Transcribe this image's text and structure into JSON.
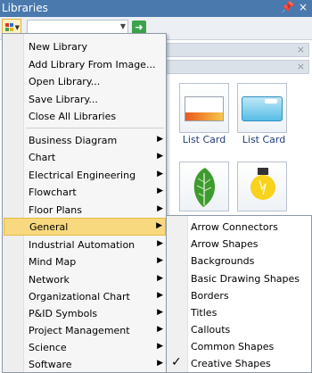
{
  "panel": {
    "title": "Libraries",
    "pin_glyph": "⌂",
    "close_glyph": "×"
  },
  "toolbar": {
    "libraries_icon": "library-grid-icon",
    "search_value": "",
    "go_icon": "go-arrow-icon"
  },
  "library_tiles": [
    {
      "label": "List Card"
    },
    {
      "label": "List Card"
    }
  ],
  "menu": {
    "top_items": [
      {
        "label": "New Library"
      },
      {
        "label": "Add Library From Image..."
      },
      {
        "label": "Open Library..."
      },
      {
        "label": "Save Library..."
      },
      {
        "label": "Close All Libraries"
      }
    ],
    "categories": [
      {
        "label": "Business Diagram"
      },
      {
        "label": "Chart"
      },
      {
        "label": "Electrical Engineering"
      },
      {
        "label": "Flowchart"
      },
      {
        "label": "Floor Plans"
      },
      {
        "label": "General"
      },
      {
        "label": "Industrial Automation"
      },
      {
        "label": "Mind Map"
      },
      {
        "label": "Network"
      },
      {
        "label": "Organizational Chart"
      },
      {
        "label": "P&ID Symbols"
      },
      {
        "label": "Project Management"
      },
      {
        "label": "Science"
      },
      {
        "label": "Software"
      }
    ],
    "active_category": "General"
  },
  "submenu": {
    "items": [
      {
        "label": "Arrow Connectors",
        "checked": false
      },
      {
        "label": "Arrow Shapes",
        "checked": false
      },
      {
        "label": "Backgrounds",
        "checked": false
      },
      {
        "label": "Basic Drawing Shapes",
        "checked": false
      },
      {
        "label": "Borders",
        "checked": false
      },
      {
        "label": "Titles",
        "checked": false
      },
      {
        "label": "Callouts",
        "checked": false
      },
      {
        "label": "Common Shapes",
        "checked": false
      },
      {
        "label": "Creative Shapes",
        "checked": true
      }
    ],
    "check_glyph": "✓"
  },
  "colors": {
    "titlebar": "#4a79ae",
    "menu_highlight": "#f8d980",
    "tile_label": "#1f3e7a"
  }
}
